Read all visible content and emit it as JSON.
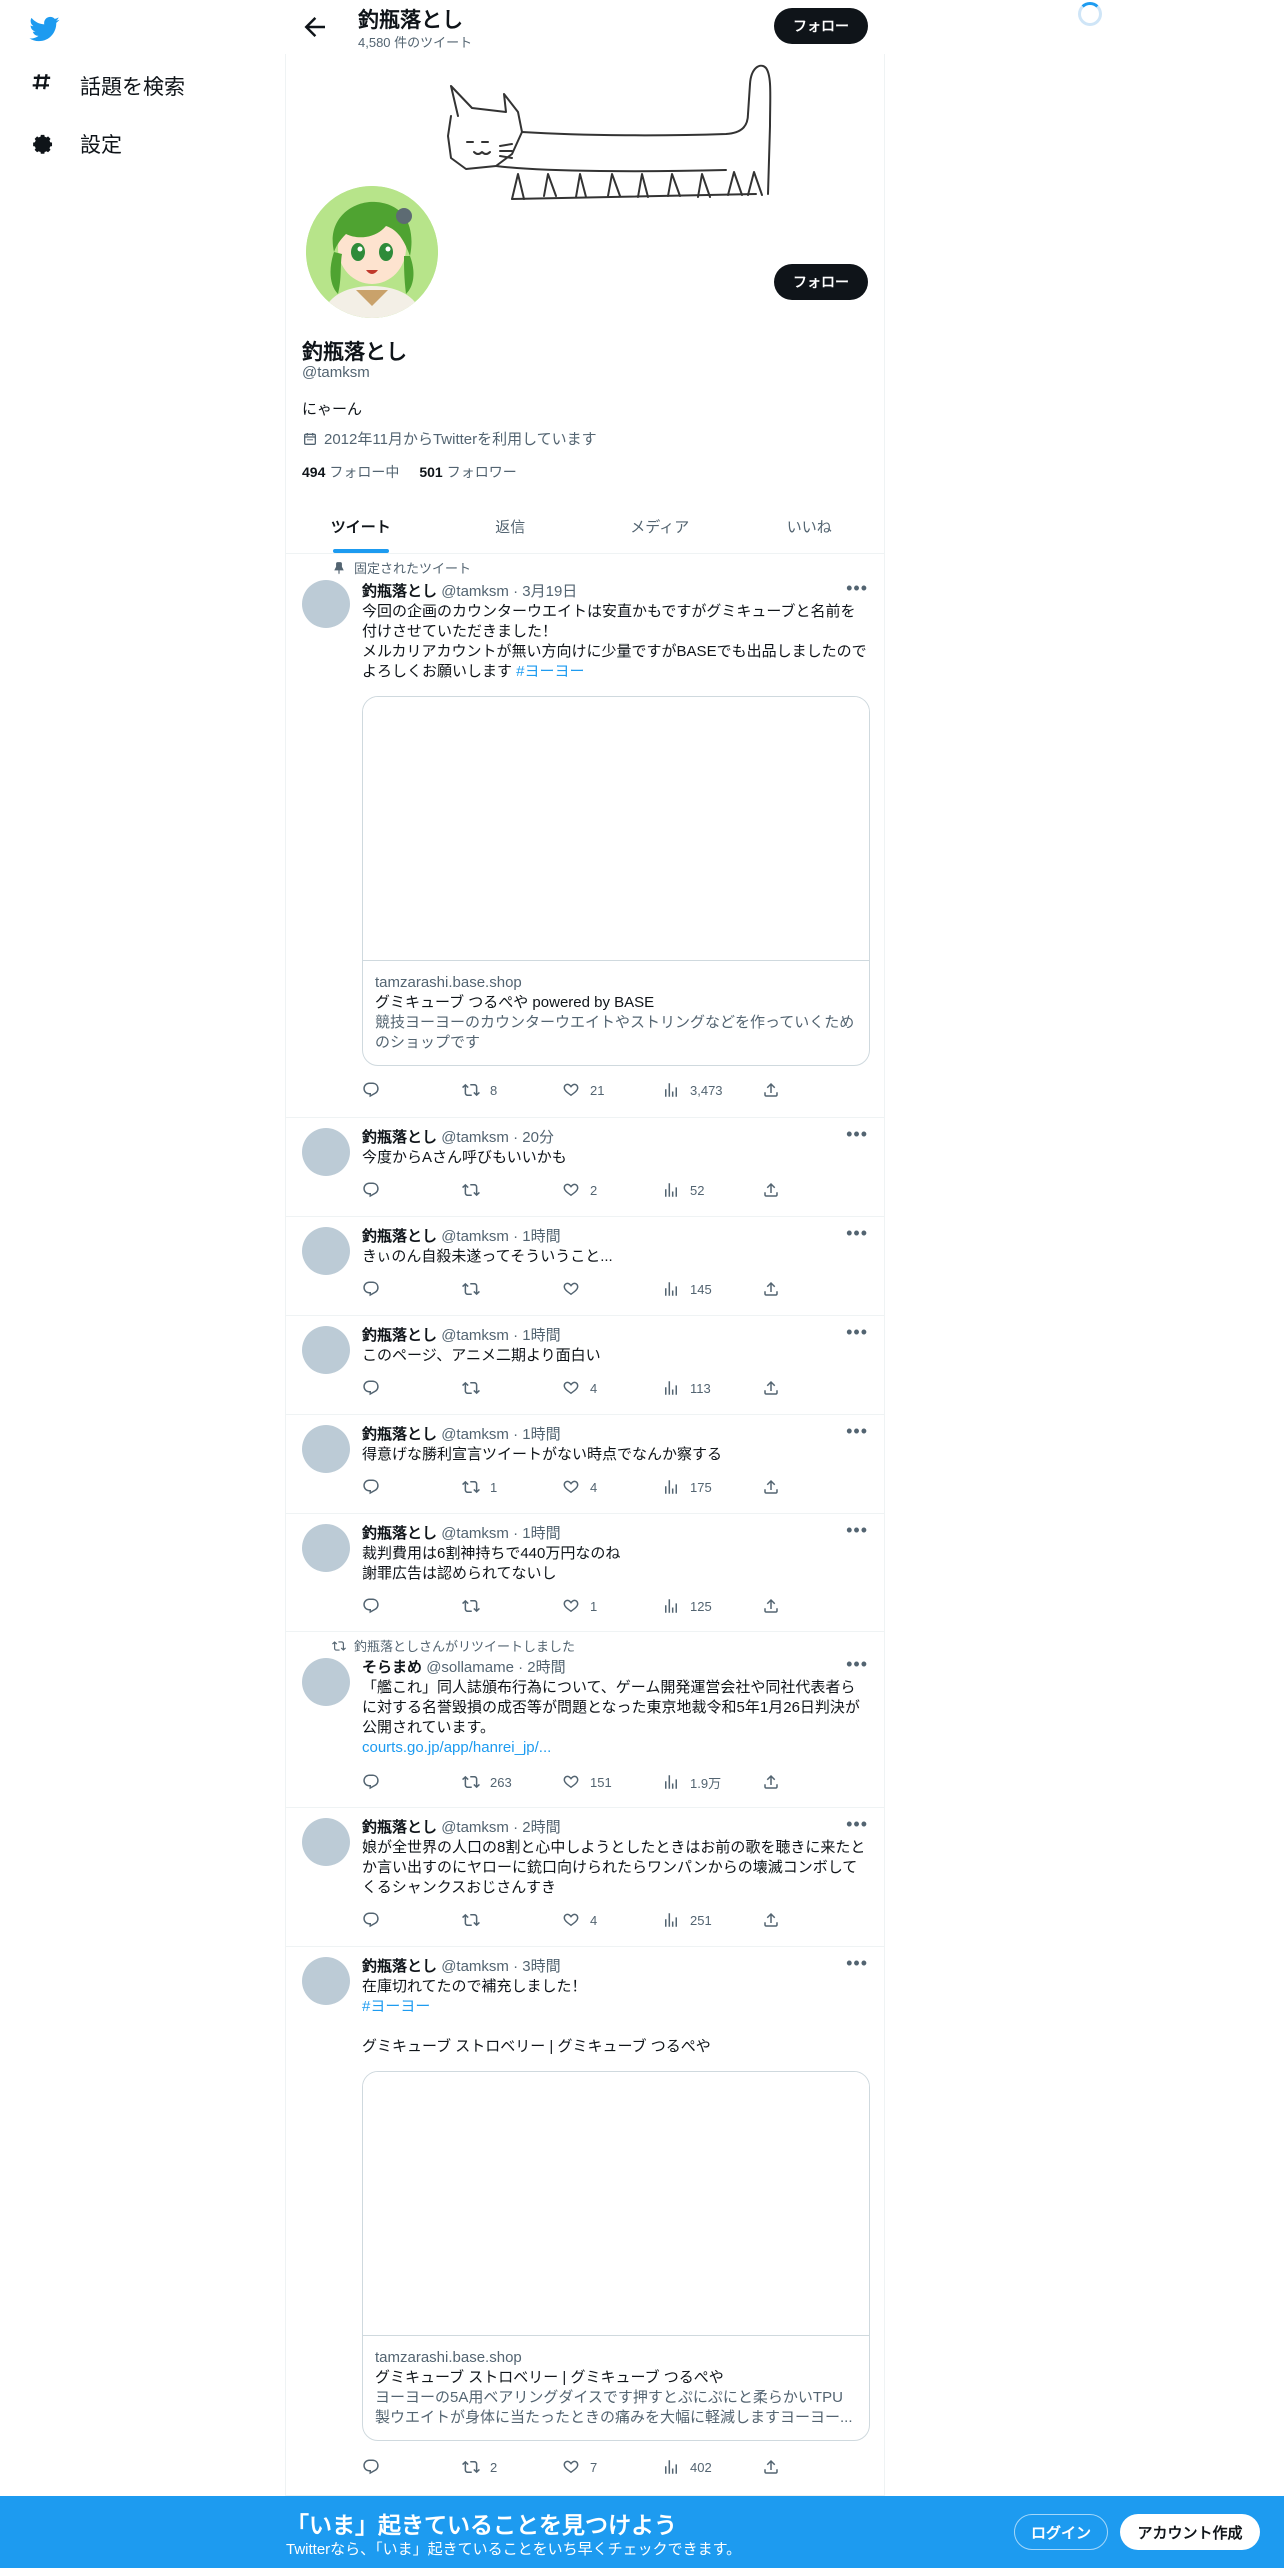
{
  "nav": {
    "items": [
      {
        "label": "話題を検索",
        "icon": "hashtag-icon"
      },
      {
        "label": "設定",
        "icon": "gear-icon"
      }
    ]
  },
  "header": {
    "title": "釣瓶落とし",
    "subtitle": "4,580 件のツイート",
    "follow_label": "フォロー"
  },
  "profile": {
    "name": "釣瓶落とし",
    "handle": "@tamksm",
    "bio": "にゃーん",
    "joined": "2012年11月からTwitterを利用しています",
    "following_count": "494",
    "following_label": "フォロー中",
    "followers_count": "501",
    "followers_label": "フォロワー",
    "follow_label": "フォロー"
  },
  "tabs": [
    "ツイート",
    "返信",
    "メディア",
    "いいね"
  ],
  "tweets": [
    {
      "social": "固定されたツイート",
      "name": "釣瓶落とし",
      "handle": "@tamksm",
      "time": "3月19日",
      "lines": [
        "今回の企画のカウンターウエイトは安直かもですがグミキューブと名前を付けさせていただきました！",
        "メルカリアカウントが無い方向けに少量ですがBASEでも出品しましたのでよろしくお願いします "
      ],
      "tag": "#ヨーヨー",
      "card": {
        "domain": "tamzarashi.base.shop",
        "title": "グミキューブ つるぺや powered by BASE",
        "desc": "競技ヨーヨーのカウンターウエイトやストリングなどを作っていくためのショップです"
      },
      "reply": "",
      "retweet": "8",
      "like": "21",
      "views": "3,473"
    },
    {
      "name": "釣瓶落とし",
      "handle": "@tamksm",
      "time": "20分",
      "text": "今度からAさん呼びもいいかも",
      "reply": "",
      "retweet": "",
      "like": "2",
      "views": "52"
    },
    {
      "name": "釣瓶落とし",
      "handle": "@tamksm",
      "time": "1時間",
      "text": "きぃのん自殺未遂ってそういうこと...",
      "reply": "",
      "retweet": "",
      "like": "",
      "views": "145"
    },
    {
      "name": "釣瓶落とし",
      "handle": "@tamksm",
      "time": "1時間",
      "text": "このページ、アニメ二期より面白い",
      "reply": "",
      "retweet": "",
      "like": "4",
      "views": "113"
    },
    {
      "name": "釣瓶落とし",
      "handle": "@tamksm",
      "time": "1時間",
      "text": "得意げな勝利宣言ツイートがない時点でなんか察する",
      "reply": "",
      "retweet": "1",
      "like": "4",
      "views": "175"
    },
    {
      "name": "釣瓶落とし",
      "handle": "@tamksm",
      "time": "1時間",
      "text": "裁判費用は6割神持ちで440万円なのね\n謝罪広告は認められてないし",
      "reply": "",
      "retweet": "",
      "like": "1",
      "views": "125"
    },
    {
      "social": "釣瓶落としさんがリツイートしました",
      "name": "そらまめ",
      "handle": "@sollamame",
      "time": "2時間",
      "text": "「艦これ」同人誌頒布行為について、ゲーム開発運営会社や同社代表者らに対する名誉毀損の成否等が問題となった東京地裁令和5年1月26日判決が公開されています。",
      "link": "courts.go.jp/app/hanrei_jp/...",
      "reply": "",
      "retweet": "263",
      "like": "151",
      "views": "1.9万"
    },
    {
      "name": "釣瓶落とし",
      "handle": "@tamksm",
      "time": "2時間",
      "text": "娘が全世界の人口の8割と心中しようとしたときはお前の歌を聴きに来たとか言い出すのにヤローに銃口向けられたらワンパンからの壊滅コンボしてくるシャンクスおじさんすき",
      "reply": "",
      "retweet": "",
      "like": "4",
      "views": "251"
    },
    {
      "name": "釣瓶落とし",
      "handle": "@tamksm",
      "time": "3時間",
      "text": "在庫切れてたので補充しました！",
      "tag": "#ヨーヨー",
      "extra": "グミキューブ ストロベリー | グミキューブ つるぺや",
      "card": {
        "domain": "tamzarashi.base.shop",
        "title": "グミキューブ ストロベリー | グミキューブ つるぺや",
        "desc": "ヨーヨーの5A用ベアリングダイスです押すとぷにぷにと柔らかいTPU製ウエイトが身体に当たったときの痛みを大幅に軽減しますヨーヨー..."
      },
      "reply": "",
      "retweet": "2",
      "like": "7",
      "views": "402"
    }
  ],
  "bottom_bar": {
    "title": "「いま」起きていることを見つけよう",
    "subtitle": "Twitterなら、「いま」起きていることをいち早くチェックできます。",
    "login": "ログイン",
    "signup": "アカウント作成"
  },
  "colors": {
    "accent": "#1d9bf0",
    "text": "#0f1419",
    "muted": "#536471"
  }
}
